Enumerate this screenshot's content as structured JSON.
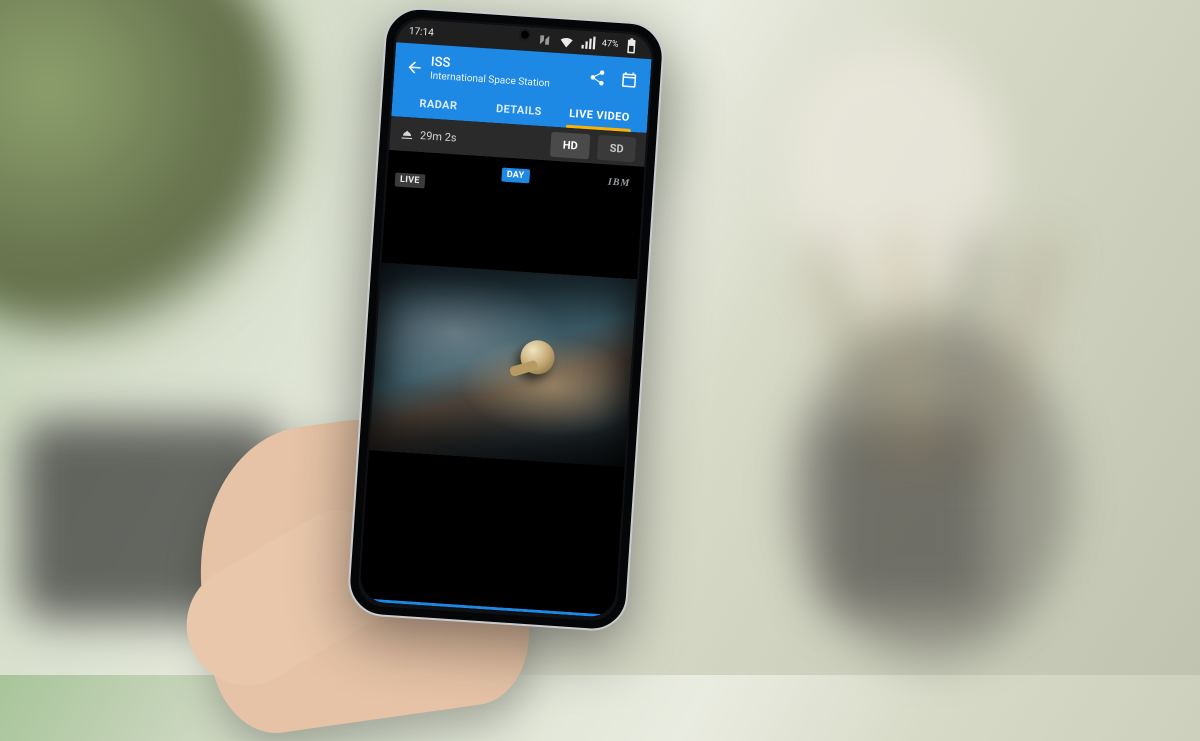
{
  "statusbar": {
    "time": "17:14",
    "battery_pct": "47%"
  },
  "appbar": {
    "title": "ISS",
    "subtitle": "International Space Station"
  },
  "tabs": {
    "radar": "RADAR",
    "details": "DETAILS",
    "live_video": "LIVE VIDEO"
  },
  "qbar": {
    "countdown": "29m 2s",
    "hd": "HD",
    "sd": "SD"
  },
  "chips": {
    "live": "LIVE",
    "day": "DAY",
    "ibm": "IBM"
  }
}
